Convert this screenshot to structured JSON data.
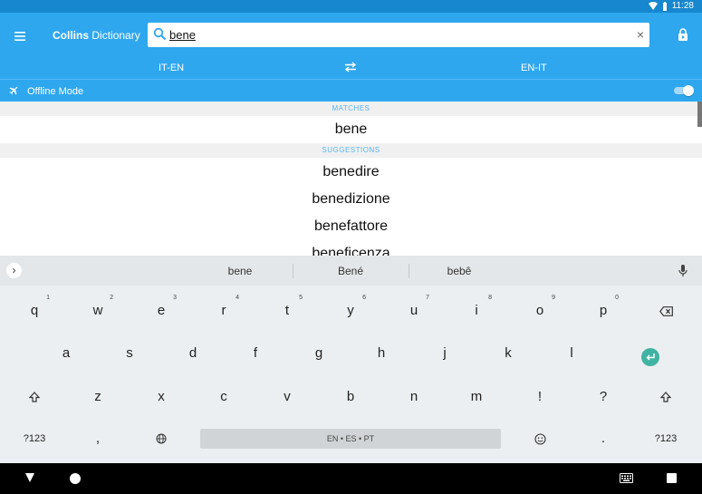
{
  "status": {
    "time": "11:28"
  },
  "app": {
    "brand_bold": "Collins",
    "brand_light": "Dictionary"
  },
  "search": {
    "value": "bene",
    "clear": "×"
  },
  "languages": {
    "left": "IT-EN",
    "right": "EN-IT"
  },
  "offline": {
    "label": "Offline Mode",
    "enabled": true
  },
  "results": {
    "matches_header": "MATCHES",
    "matches": [
      "bene"
    ],
    "suggestions_header": "SUGGESTIONS",
    "suggestions": [
      "benedire",
      "benedizione",
      "benefattore",
      "beneficenza"
    ]
  },
  "keyboard": {
    "suggestions": [
      "bene",
      "Bené",
      "bebê"
    ],
    "row1": [
      {
        "k": "q",
        "h": "1"
      },
      {
        "k": "w",
        "h": "2"
      },
      {
        "k": "e",
        "h": "3"
      },
      {
        "k": "r",
        "h": "4"
      },
      {
        "k": "t",
        "h": "5"
      },
      {
        "k": "y",
        "h": "6"
      },
      {
        "k": "u",
        "h": "7"
      },
      {
        "k": "i",
        "h": "8"
      },
      {
        "k": "o",
        "h": "9"
      },
      {
        "k": "p",
        "h": "0"
      }
    ],
    "row2": [
      "a",
      "s",
      "d",
      "f",
      "g",
      "h",
      "j",
      "k",
      "l"
    ],
    "row3": [
      "z",
      "x",
      "c",
      "v",
      "b",
      "n",
      "m",
      "!",
      "?"
    ],
    "symbols_label": "?123",
    "comma": ",",
    "period": ".",
    "space_label": "EN • ES • PT"
  },
  "colors": {
    "statusbar": "#1787cf",
    "appbar": "#2ea7ee",
    "accent": "#5ab6ee",
    "enter": "#41b3a3"
  }
}
